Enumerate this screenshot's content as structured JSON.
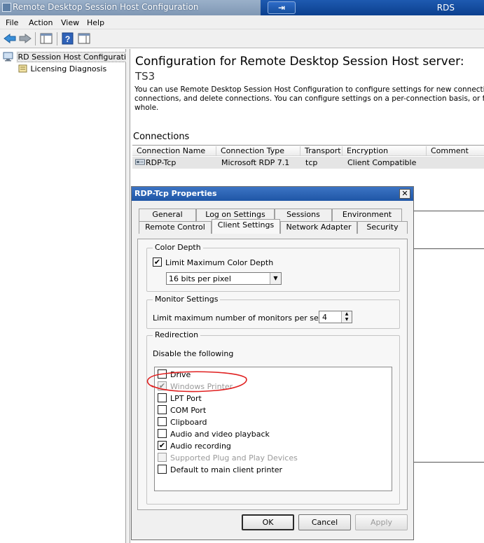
{
  "window": {
    "title": "Remote Desktop Session Host Configuration",
    "rds_pin_label": "⇥",
    "rds_label": "RDS"
  },
  "menu": [
    "File",
    "Action",
    "View",
    "Help"
  ],
  "tree": {
    "root": "RD Session Host Configuration:",
    "child": "Licensing Diagnosis"
  },
  "main": {
    "heading": "Configuration for Remote Desktop Session Host server:",
    "server": "TS3",
    "description_lines": [
      "You can use Remote Desktop Session Host Configuration to configure settings for new connections, modi",
      "connections, and delete connections. You can configure settings on a per-connection basis, or for the RD",
      "whole."
    ],
    "connections_title": "Connections",
    "columns": [
      "Connection Name",
      "Connection Type",
      "Transport",
      "Encryption",
      "Comment"
    ],
    "rows": [
      {
        "name": "RDP-Tcp",
        "type": "Microsoft RDP 7.1",
        "transport": "tcp",
        "encryption": "Client Compatible",
        "comment": ""
      }
    ]
  },
  "dialog": {
    "title": "RDP-Tcp Properties",
    "close_label": "✕",
    "tabs_back": [
      "General",
      "Log on Settings",
      "Sessions",
      "Environment"
    ],
    "tabs_front": [
      "Remote Control",
      "Client Settings",
      "Network Adapter",
      "Security"
    ],
    "active_tab": "Client Settings",
    "color_depth": {
      "group_label": "Color Depth",
      "limit_label": "Limit Maximum Color Depth",
      "limit_checked": true,
      "selected_value": "16 bits per pixel"
    },
    "monitor": {
      "group_label": "Monitor Settings",
      "limit_label": "Limit maximum number of monitors per session",
      "value": "4"
    },
    "redirection": {
      "group_label": "Redirection",
      "subtitle": "Disable the following",
      "items": [
        {
          "label": "Drive",
          "checked": false,
          "disabled": false
        },
        {
          "label": "Windows Printer",
          "checked": true,
          "disabled": true
        },
        {
          "label": "LPT Port",
          "checked": false,
          "disabled": false
        },
        {
          "label": "COM Port",
          "checked": false,
          "disabled": false
        },
        {
          "label": "Clipboard",
          "checked": false,
          "disabled": false
        },
        {
          "label": "Audio and video playback",
          "checked": false,
          "disabled": false
        },
        {
          "label": "Audio recording",
          "checked": true,
          "disabled": false
        },
        {
          "label": "Supported Plug and Play Devices",
          "checked": false,
          "disabled": true
        },
        {
          "label": "Default to main client printer",
          "checked": false,
          "disabled": false
        }
      ]
    },
    "buttons": {
      "ok": "OK",
      "cancel": "Cancel",
      "apply": "Apply"
    }
  },
  "colors": {
    "titlebar": "#8aa2c0",
    "rds_bar": "#1449a0",
    "dialog_title": "#2a63b5",
    "annotation": "#e02020"
  }
}
